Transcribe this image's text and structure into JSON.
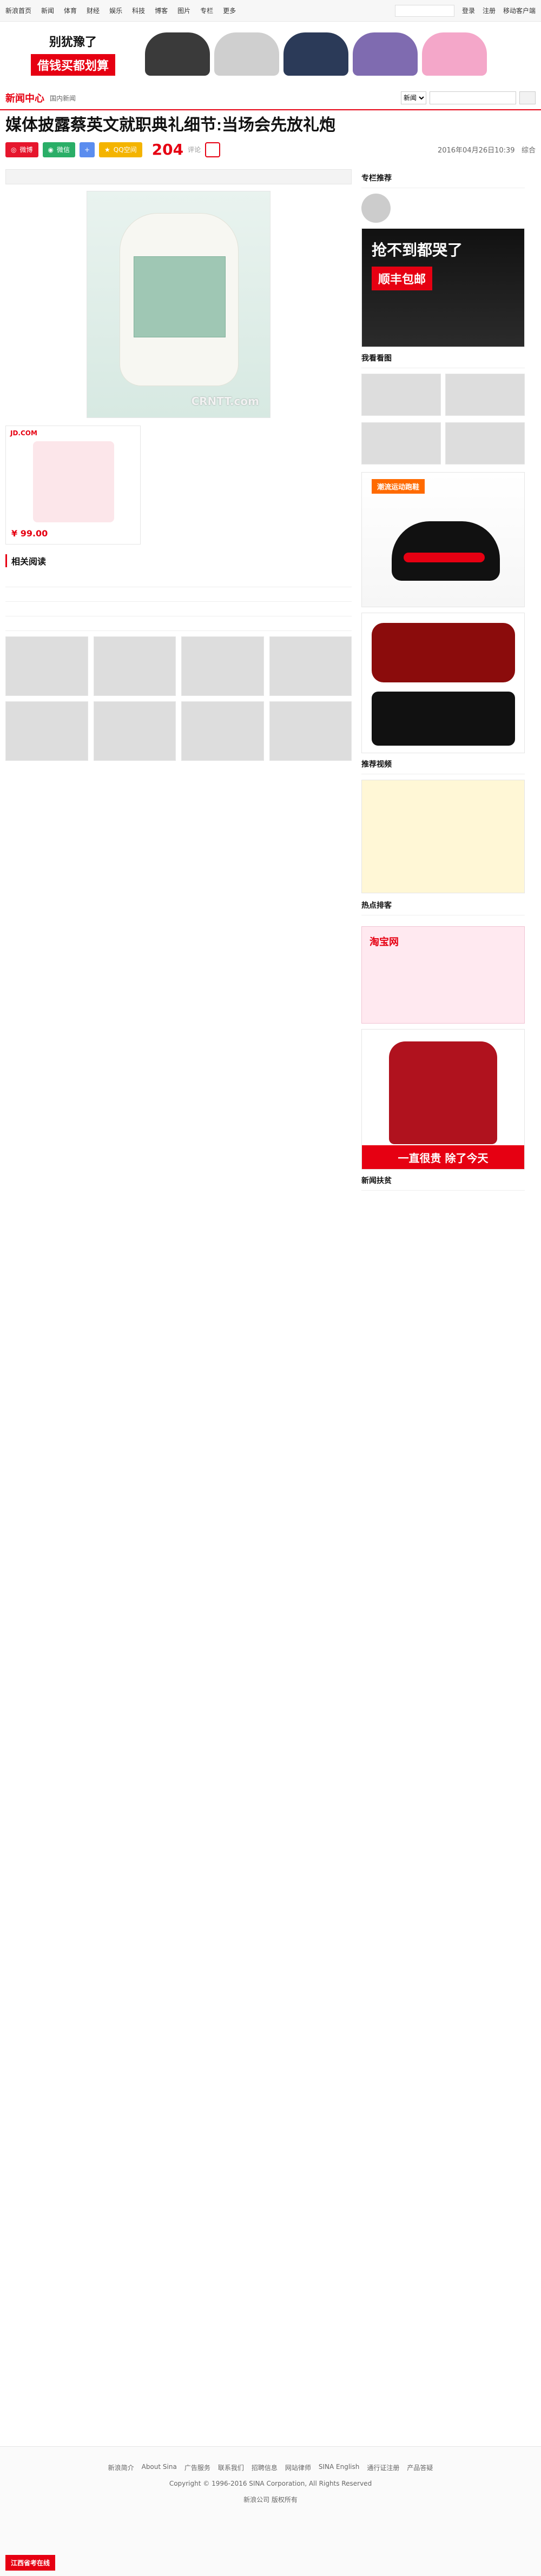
{
  "topnav": {
    "items": [
      "新浪首页",
      "新闻",
      "体育",
      "财经",
      "娱乐",
      "科技",
      "博客",
      "图片",
      "专栏",
      "更多"
    ],
    "right": {
      "login": "登录",
      "register": "注册",
      "mobile": "移动客户端"
    }
  },
  "adbanner": {
    "title": "别犹豫了",
    "cta": "借钱买都划算"
  },
  "channel": {
    "logo": "新闻中心",
    "name": "国内新闻",
    "search": {
      "select": "新闻",
      "placeholder": "",
      "button": ""
    }
  },
  "headline": {
    "title": "媒体披露蔡英文就职典礼细节:当场会先放礼炮"
  },
  "share": {
    "weibo": "微博",
    "wechat": "微信",
    "plus": "+",
    "qzone": "QQ空间",
    "count": "204",
    "count_label": "评论",
    "datetime": "2016年04月26日10:39",
    "tail": "综合"
  },
  "article": {
    "flash_hint": "",
    "caption": "",
    "paragraphs": [
      "",
      "",
      "",
      "",
      "",
      "",
      ""
    ]
  },
  "inline_ad": {
    "jd_tag": "JD.COM",
    "price": "¥ 99.00"
  },
  "related": {
    "title": "相关阅读",
    "items": [
      {
        "title": "",
        "desc": "",
        "meta_left": "",
        "meta_right": ""
      },
      {
        "title": "",
        "desc": "",
        "meta_left": "",
        "meta_right": ""
      },
      {
        "title": "",
        "desc": "",
        "meta_left": "",
        "meta_right": ""
      },
      {
        "title": "",
        "desc": "",
        "meta_left": "",
        "meta_right": ""
      }
    ]
  },
  "side": {
    "expert_title": "专栏推荐",
    "expert_more": "",
    "expert_text": "",
    "bigad_text": "抢不到都哭了",
    "bigad_btn": "顺丰包邮",
    "my_title": "我看看图",
    "grid": [
      {
        "cap": ""
      },
      {
        "cap": ""
      },
      {
        "cap": ""
      },
      {
        "cap": ""
      }
    ],
    "ad2_badge": "潮流运动跑鞋",
    "ad3_title": "",
    "rec_title": "推荐视频",
    "hot_title": "热点排客",
    "hot_list": [
      "",
      "",
      "",
      "",
      "",
      "",
      ""
    ],
    "ad4_title": "淘宝网",
    "ad5_bar": "一直很贵 除了今天",
    "new_title": "新闻扶贫"
  },
  "footer": {
    "links": [
      "新浪简介",
      "About Sina",
      "广告服务",
      "联系我们",
      "招聘信息",
      "网站律师",
      "SINA English",
      "通行证注册",
      "产品答疑"
    ],
    "copy": "Copyright © 1996-2016 SINA Corporation, All Rights Reserved",
    "copy2": "新浪公司 版权所有",
    "bottom_btn": "江西省考在线"
  }
}
